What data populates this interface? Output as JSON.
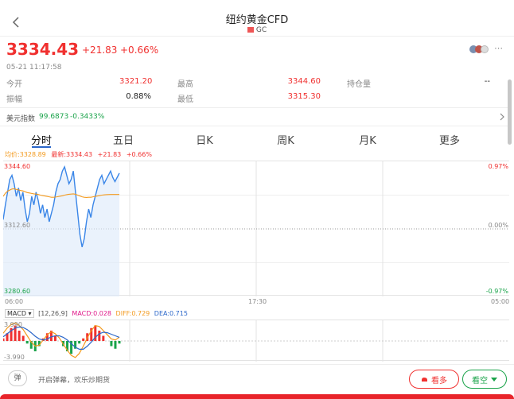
{
  "header": {
    "title": "纽约黄金CFD",
    "symbol": "GC",
    "back_icon": "chevron-left-icon",
    "more_icon": "ellipsis-icon"
  },
  "quote": {
    "price": "3334.43",
    "change": "+21.83",
    "change_pct": "+0.66%",
    "datetime": "05-21 11:17:58",
    "open_label": "今开",
    "open": "3321.20",
    "high_label": "最高",
    "high": "3344.60",
    "oi_label": "持仓量",
    "oi": "--",
    "amp_label": "振幅",
    "amp": "0.88%",
    "low_label": "最低",
    "low": "3315.30"
  },
  "usd_index": {
    "label": "美元指数",
    "value": "99.6873",
    "change": "-0.3433%"
  },
  "tabs": [
    "分时",
    "五日",
    "日K",
    "周K",
    "月K",
    "更多"
  ],
  "chart_header": {
    "avg": "均价:3328.89",
    "latest": "最新:3334.43",
    "change": "+21.83",
    "pct": "+0.66%"
  },
  "chart_data": {
    "type": "line",
    "title": "",
    "y_labels_left": [
      "3344.60",
      "3312.60",
      "3280.60"
    ],
    "y_labels_right": [
      "0.97%",
      "0.00%",
      "-0.97%"
    ],
    "x_labels": [
      "06:00",
      "17:30",
      "05:00"
    ],
    "ylim": [
      3280.6,
      3344.6
    ],
    "series": [
      {
        "values": [
          3317,
          3324,
          3330,
          3336,
          3338,
          3334,
          3328,
          3332,
          3326,
          3330,
          3322,
          3316,
          3320,
          3328,
          3324,
          3330,
          3326,
          3320,
          3324,
          3318,
          3322,
          3316,
          3320,
          3324,
          3330,
          3334,
          3336,
          3340,
          3342,
          3338,
          3334,
          3336,
          3340,
          3330,
          3320,
          3310,
          3304,
          3308,
          3316,
          3322,
          3318,
          3324,
          3328,
          3332,
          3336,
          3338,
          3334,
          3336,
          3338,
          3340,
          3337,
          3335,
          3337,
          3339
        ]
      },
      {
        "values": [
          3328,
          3329.5,
          3330.5,
          3331,
          3331.5,
          3331.6,
          3331.3,
          3331.1,
          3330.8,
          3330.6,
          3330.2,
          3329.8,
          3329.6,
          3329.4,
          3329.2,
          3329.1,
          3328.9,
          3328.6,
          3328.4,
          3328.2,
          3328.0,
          3327.8,
          3327.6,
          3327.6,
          3327.7,
          3327.9,
          3328.1,
          3328.3,
          3328.6,
          3328.8,
          3329.0,
          3329.1,
          3329.2,
          3329.0,
          3328.6,
          3328.2,
          3327.8,
          3327.6,
          3327.5,
          3327.6,
          3327.6,
          3327.8,
          3328.0,
          3328.2,
          3328.4,
          3328.6,
          3328.7,
          3328.8,
          3328.85,
          3328.9,
          3328.9,
          3328.9,
          3328.9,
          3328.89
        ]
      }
    ]
  },
  "macd": {
    "label": "MACD",
    "params": "[12,26,9]",
    "macd": "MACD:0.028",
    "diff": "DIFF:0.729",
    "dea": "DEA:0.715",
    "y_top": "3.990",
    "y_bottom": "-3.990",
    "hist": [
      0.5,
      1.5,
      2.5,
      3.0,
      2.0,
      1.0,
      -0.5,
      -1.5,
      -2.0,
      -1.0,
      0.5,
      1.5,
      2.0,
      1.0,
      0.0,
      -1.0,
      -2.0,
      -2.5,
      -1.5,
      -0.5,
      0.5,
      1.5,
      2.5,
      3.0,
      2.0,
      1.0,
      0.0,
      -1.0,
      -1.5,
      -0.5
    ],
    "diff_line": [
      1.5,
      2.5,
      3.2,
      3.5,
      3.0,
      2.2,
      1.0,
      -0.2,
      -1.0,
      -0.8,
      0.2,
      1.2,
      1.8,
      1.4,
      0.6,
      -0.6,
      -1.8,
      -2.8,
      -3.2,
      -2.4,
      -1.0,
      0.6,
      2.0,
      3.0,
      2.8,
      2.0,
      1.2,
      0.4,
      0.2,
      0.73
    ],
    "dea_line": [
      0.8,
      1.4,
      2.0,
      2.5,
      2.7,
      2.6,
      2.2,
      1.6,
      0.9,
      0.4,
      0.2,
      0.4,
      0.8,
      1.0,
      1.0,
      0.7,
      0.2,
      -0.5,
      -1.2,
      -1.6,
      -1.6,
      -1.0,
      -0.2,
      0.7,
      1.4,
      1.7,
      1.6,
      1.3,
      1.0,
      0.715
    ]
  },
  "footer": {
    "barrage_icon": "barrage-icon",
    "placeholder": "开启弹幕，欢乐炒期货",
    "bull": "看多",
    "bear": "看空",
    "bull_color": "#f0302f",
    "bear_color": "#1aa34a"
  }
}
